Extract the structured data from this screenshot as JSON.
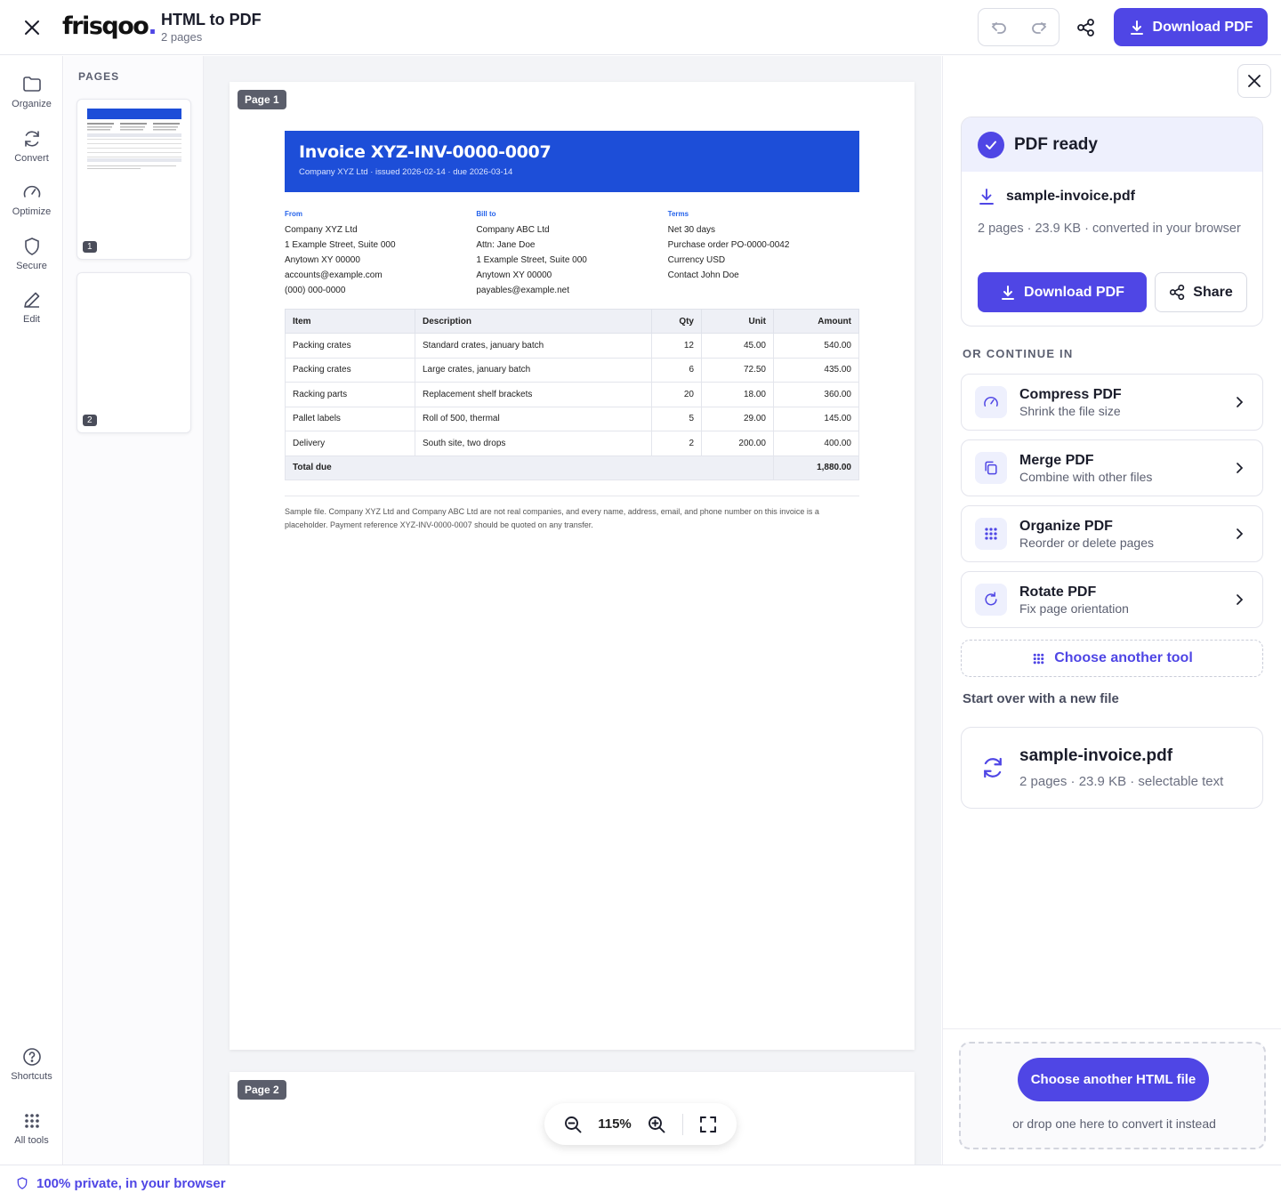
{
  "header": {
    "logo": "frisqoo",
    "title": "HTML to PDF",
    "subtitle": "2 pages",
    "download_label": "Download PDF"
  },
  "rail": {
    "items": [
      {
        "label": "Organize",
        "icon": "folder-icon"
      },
      {
        "label": "Convert",
        "icon": "refresh-icon"
      },
      {
        "label": "Optimize",
        "icon": "gauge-icon"
      },
      {
        "label": "Secure",
        "icon": "shield-icon"
      },
      {
        "label": "Edit",
        "icon": "pencil-icon"
      }
    ],
    "bottom": [
      {
        "label": "Shortcuts",
        "icon": "help-icon"
      },
      {
        "label": "All tools",
        "icon": "grid-icon"
      }
    ]
  },
  "pages_panel": {
    "label": "PAGES",
    "thumbs": [
      "1",
      "2"
    ]
  },
  "viewer": {
    "page1_tag": "Page 1",
    "page2_tag": "Page 2",
    "zoom": "115%"
  },
  "invoice": {
    "title": "Invoice XYZ-INV-0000-0007",
    "meta": "Company XYZ Ltd · issued 2026-02-14 · due 2026-03-14",
    "from": {
      "label": "From",
      "lines": [
        "Company XYZ Ltd",
        "1 Example Street, Suite 000",
        "Anytown XY 00000",
        "accounts@example.com",
        "(000) 000-0000"
      ]
    },
    "bill_to": {
      "label": "Bill to",
      "lines": [
        "Company ABC Ltd",
        "Attn: Jane Doe",
        "1 Example Street, Suite 000",
        "Anytown XY 00000",
        "payables@example.net"
      ]
    },
    "terms": {
      "label": "Terms",
      "lines": [
        "Net 30 days",
        "Purchase order PO-0000-0042",
        "Currency USD",
        "Contact John Doe"
      ]
    },
    "columns": [
      "Item",
      "Description",
      "Qty",
      "Unit",
      "Amount"
    ],
    "rows": [
      [
        "Packing crates",
        "Standard crates, january batch",
        "12",
        "45.00",
        "540.00"
      ],
      [
        "Packing crates",
        "Large crates, january batch",
        "6",
        "72.50",
        "435.00"
      ],
      [
        "Racking parts",
        "Replacement shelf brackets",
        "20",
        "18.00",
        "360.00"
      ],
      [
        "Pallet labels",
        "Roll of 500, thermal",
        "5",
        "29.00",
        "145.00"
      ],
      [
        "Delivery",
        "South site, two drops",
        "2",
        "200.00",
        "400.00"
      ]
    ],
    "total_label": "Total due",
    "total_value": "1,880.00",
    "footnote": "Sample file. Company XYZ Ltd and Company ABC Ltd are not real companies, and every name, address, email, and phone number on this invoice is a placeholder. Payment reference XYZ-INV-0000-0007 should be quoted on any transfer."
  },
  "result": {
    "status": "PDF ready",
    "file_name": "sample-invoice.pdf",
    "file_meta": "2 pages · 23.9 KB · converted in your browser",
    "download_label": "Download PDF",
    "share_label": "Share",
    "continue_label": "OR CONTINUE IN",
    "tools": [
      {
        "name": "Compress PDF",
        "desc": "Shrink the file size",
        "icon": "gauge-icon"
      },
      {
        "name": "Merge PDF",
        "desc": "Combine with other files",
        "icon": "copy-icon"
      },
      {
        "name": "Organize PDF",
        "desc": "Reorder or delete pages",
        "icon": "grid-icon"
      },
      {
        "name": "Rotate PDF",
        "desc": "Fix page orientation",
        "icon": "rotate-icon"
      }
    ],
    "choose_tool_label": "Choose another tool",
    "startover_label": "Start over with a new file",
    "recent_name": "sample-invoice.pdf",
    "recent_meta": "2 pages · 23.9 KB · selectable text",
    "choose_file_label": "Choose another HTML file",
    "drop_note": "or drop one here to convert it instead"
  },
  "status": {
    "privacy": "100% private, in your browser"
  },
  "colors": {
    "accent": "#4f46e5",
    "invoice_blue": "#1d4ed8"
  }
}
